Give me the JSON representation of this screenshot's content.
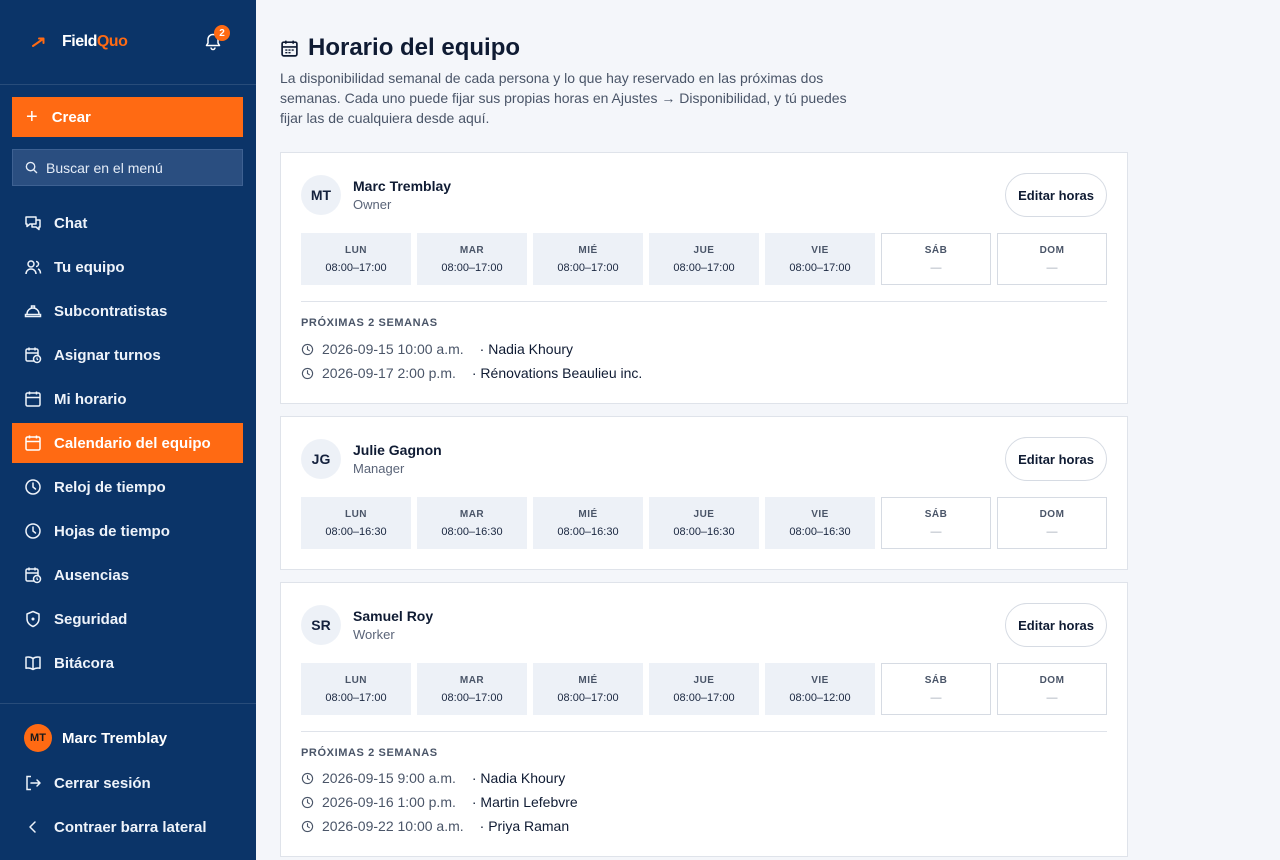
{
  "brand": {
    "name_a": "Field",
    "name_b": "Quo",
    "notification_count": "2",
    "accent": "#ff6a13",
    "sidebar_bg": "#0b3468"
  },
  "sidebar": {
    "create_label": "Crear",
    "search_placeholder": "Buscar en el menú",
    "items": [
      {
        "label": "Chat",
        "icon": "chat-icon"
      },
      {
        "label": "Tu equipo",
        "icon": "team-icon"
      },
      {
        "label": "Subcontratistas",
        "icon": "hard-hat-icon"
      },
      {
        "label": "Asignar turnos",
        "icon": "calendar-clock-icon"
      },
      {
        "label": "Mi horario",
        "icon": "calendar-icon"
      },
      {
        "label": "Calendario del equipo",
        "icon": "calendar-icon",
        "active": true
      },
      {
        "label": "Reloj de tiempo",
        "icon": "clock-icon"
      },
      {
        "label": "Hojas de tiempo",
        "icon": "clock-icon"
      },
      {
        "label": "Ausencias",
        "icon": "calendar-clock-icon"
      },
      {
        "label": "Seguridad",
        "icon": "shield-icon"
      },
      {
        "label": "Bitácora",
        "icon": "book-icon"
      }
    ],
    "user": {
      "initials": "MT",
      "name": "Marc Tremblay"
    },
    "logout_label": "Cerrar sesión",
    "collapse_label": "Contraer barra lateral"
  },
  "page": {
    "title": "Horario del equipo",
    "description": "La disponibilidad semanal de cada persona y lo que hay reservado en las próximas dos semanas. Cada uno puede fijar sus propias horas en Ajustes → Disponibilidad, y tú puedes fijar las de cualquiera desde aquí.",
    "edit_label": "Editar horas",
    "upcoming_title": "PRÓXIMAS 2 SEMANAS"
  },
  "people": [
    {
      "initials": "MT",
      "name": "Marc Tremblay",
      "role": "Owner",
      "days": [
        {
          "day": "LUN",
          "hours": "08:00–17:00"
        },
        {
          "day": "MAR",
          "hours": "08:00–17:00"
        },
        {
          "day": "MIÉ",
          "hours": "08:00–17:00"
        },
        {
          "day": "JUE",
          "hours": "08:00–17:00"
        },
        {
          "day": "VIE",
          "hours": "08:00–17:00"
        },
        {
          "day": "SÁB",
          "hours": "—",
          "off": true
        },
        {
          "day": "DOM",
          "hours": "—",
          "off": true
        }
      ],
      "bookings": [
        {
          "when": "2026-09-15 10:00 a.m.",
          "who": "· Nadia Khoury"
        },
        {
          "when": "2026-09-17 2:00 p.m.",
          "who": "· Rénovations Beaulieu inc."
        }
      ]
    },
    {
      "initials": "JG",
      "name": "Julie Gagnon",
      "role": "Manager",
      "days": [
        {
          "day": "LUN",
          "hours": "08:00–16:30"
        },
        {
          "day": "MAR",
          "hours": "08:00–16:30"
        },
        {
          "day": "MIÉ",
          "hours": "08:00–16:30"
        },
        {
          "day": "JUE",
          "hours": "08:00–16:30"
        },
        {
          "day": "VIE",
          "hours": "08:00–16:30"
        },
        {
          "day": "SÁB",
          "hours": "—",
          "off": true
        },
        {
          "day": "DOM",
          "hours": "—",
          "off": true
        }
      ],
      "bookings": []
    },
    {
      "initials": "SR",
      "name": "Samuel Roy",
      "role": "Worker",
      "days": [
        {
          "day": "LUN",
          "hours": "08:00–17:00"
        },
        {
          "day": "MAR",
          "hours": "08:00–17:00"
        },
        {
          "day": "MIÉ",
          "hours": "08:00–17:00"
        },
        {
          "day": "JUE",
          "hours": "08:00–17:00"
        },
        {
          "day": "VIE",
          "hours": "08:00–12:00"
        },
        {
          "day": "SÁB",
          "hours": "—",
          "off": true
        },
        {
          "day": "DOM",
          "hours": "—",
          "off": true
        }
      ],
      "bookings": [
        {
          "when": "2026-09-15 9:00 a.m.",
          "who": "· Nadia Khoury"
        },
        {
          "when": "2026-09-16 1:00 p.m.",
          "who": "· Martin Lefebvre"
        },
        {
          "when": "2026-09-22 10:00 a.m.",
          "who": "· Priya Raman"
        }
      ]
    }
  ]
}
